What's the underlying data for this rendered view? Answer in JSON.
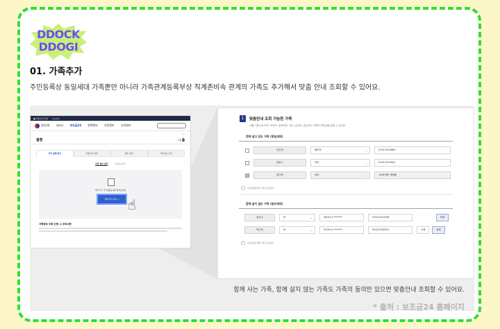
{
  "logo": {
    "line1": "DDOCK",
    "line2": "DDOGI"
  },
  "section": {
    "title": "01. 가족추가",
    "description": "주민등록상 동일세대 가족뿐만 아니라 가족관계등록부상 직계존비속 관계의 가족도 추가해서 맞춤 안내 조회할 수 있어요."
  },
  "site": {
    "name": "정부24",
    "nav": [
      "서비스",
      "보조금24",
      "정책정보",
      "기관정보",
      "고객센터"
    ],
    "page_title": "설정",
    "tabs": [
      "가족 실행/관리",
      "맞춤안내 항목",
      "알림 설정",
      "개인정보 관리"
    ],
    "active_tab": 0,
    "subtabs": [
      "가족 정보 관리",
      "내 정보 관리"
    ],
    "empty_text": "가족 추가 후 맞춤안내를 받아보세요",
    "add_button": "가족 추가 하기 +",
    "notes_title": "가족정보 조회 신청 시 주의사항"
  },
  "panel": {
    "step": "1",
    "title": "맞춤안내 조회 가능한 가족",
    "subtitle": "나를 기준으로 부모, 조부모, 증조부모, 자녀, 손자녀, 증손자녀 가족의 보조금을 받을 수 있어요.",
    "group1_title": "현재 살고 있는 가족 (동일세대)",
    "group1_rows": [
      {
        "name": "김민희",
        "relation": "배우자",
        "id": "03012345680",
        "disabled": false
      },
      {
        "name": "홍동수",
        "relation": "자녀",
        "id": "03012345002",
        "disabled": false
      },
      {
        "name": "홍연희",
        "relation": "자녀",
        "id": "14세 미만 세대원",
        "disabled": true
      }
    ],
    "agree_text": "(선택)동일세대 가족 조회 동의",
    "group2_title": "함께 살지 않는 가족 (분리세대)",
    "group2_rows": [
      {
        "name": "홍길수",
        "relation": "부",
        "rrn": "480101-*******",
        "phone": "03012345348",
        "actions": [
          "등록"
        ]
      },
      {
        "name": "박순희",
        "relation": "모",
        "rrn": "520101-*******",
        "phone": "03012348352",
        "actions": [
          "삭제",
          "등록"
        ]
      }
    ],
    "agree_text2": "(선택)분리세대 가족 조회 동의"
  },
  "caption": "함께 사는 가족, 함께 살지 않는 가족도 가족의 동의만 있으면 맞춤안내 조회할 수 있어요.",
  "source": "* 출처 : 보조금24 홈페이지"
}
